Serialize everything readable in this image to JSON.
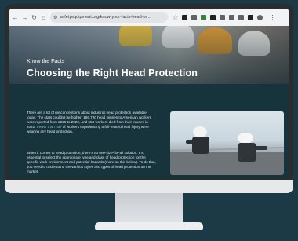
{
  "browser": {
    "url": "safetyequipment.org/know-your-facts-head-pr...",
    "colors": {
      "chrome": "#f1f3f4",
      "page_bg": "#17343d",
      "link": "#6fc3c8"
    }
  },
  "hero": {
    "label": "Know the Facts",
    "title": "Choosing the Right Head Protection"
  },
  "article": {
    "para1_before": "There are a lot of misconceptions about industrial head protection available today. The stats couldn't be higher: 196,720 head injuries to American workers were reported from 2020 to 2022, and 684 workers died from their injuries in 2022.",
    "para1_link": "Fewer than half",
    "para1_after": "of workers experiencing a fall-related head injury were wearing any head protection.",
    "para2": "When it comes to head protection, there's no one-size-fits-all solution. It's essential to select the appropriate type and class of head protection for the specific work environment and potential hazards (more on this below). To do that, you need to understand the various styles and types of head protection on the market."
  }
}
